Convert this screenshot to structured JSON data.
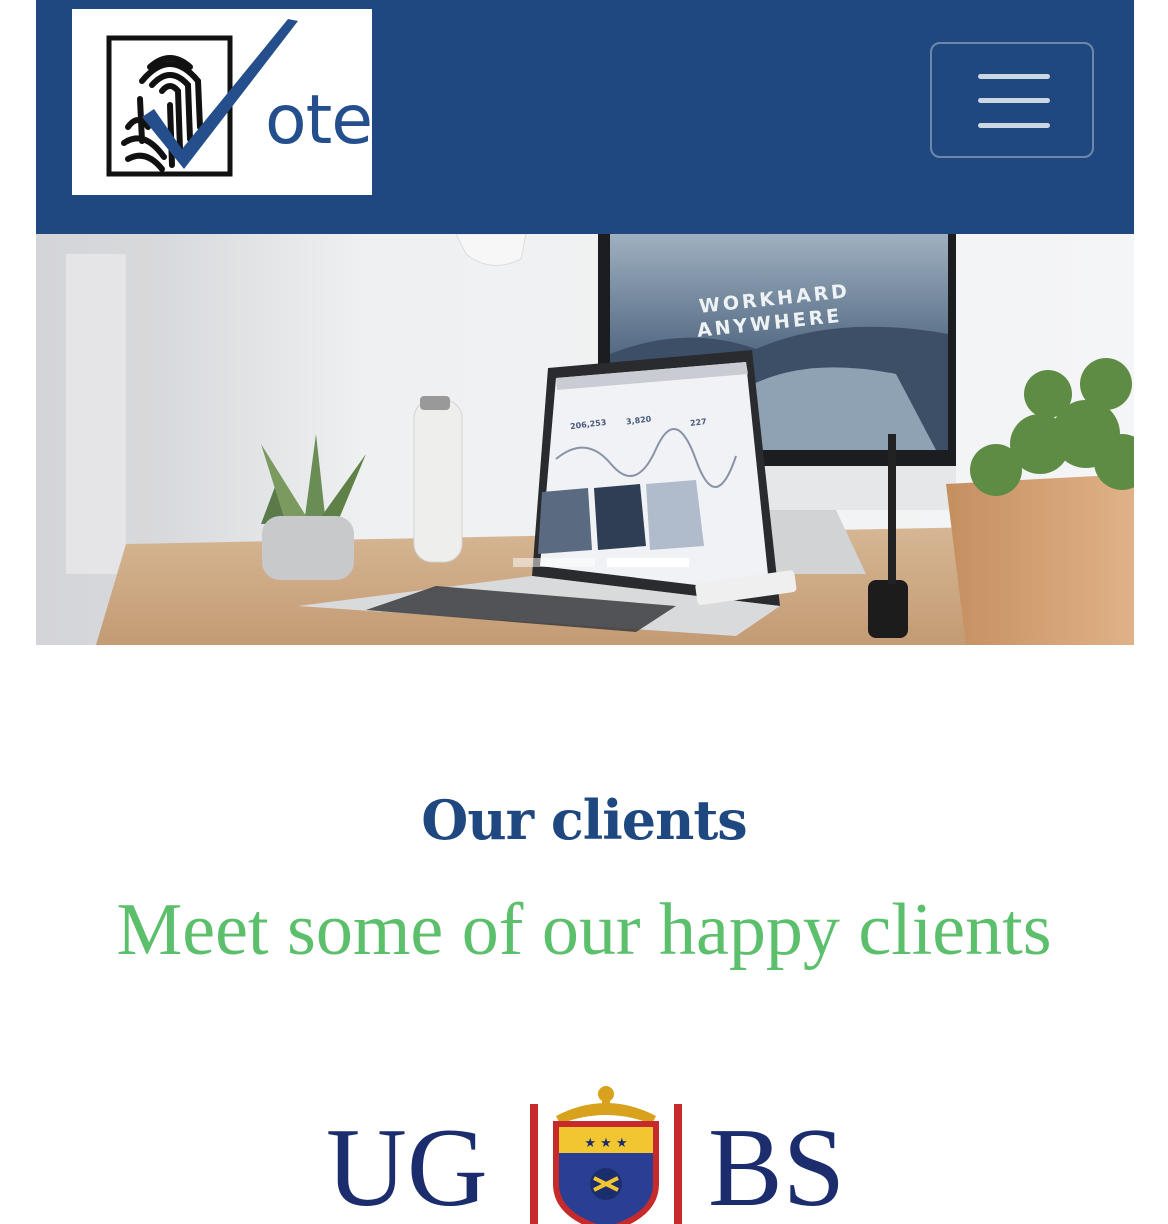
{
  "navbar": {
    "brand_text": "ote",
    "brand_logo_icon": "fingerprint-checkmark-logo",
    "menu_icon": "hamburger-menu-icon",
    "colors": {
      "background": "#1f4880",
      "brand_text": "#244f8c"
    }
  },
  "hero": {
    "screen_text_line1": "WORKHARD",
    "screen_text_line2": "ANYWHERE",
    "laptop_stats": [
      "206,253",
      "3,820",
      "227"
    ],
    "carousel": {
      "slide_count": 2,
      "active_index": 1
    }
  },
  "clients": {
    "heading": "Our clients",
    "subheading": "Meet some of our happy clients",
    "logo": {
      "left_text": "UG",
      "right_text": "BS",
      "emblem_icon": "crest-shield-icon"
    },
    "colors": {
      "heading": "#1f4880",
      "subheading": "#5cbf6c",
      "logo_text": "#1c2d6e"
    }
  }
}
